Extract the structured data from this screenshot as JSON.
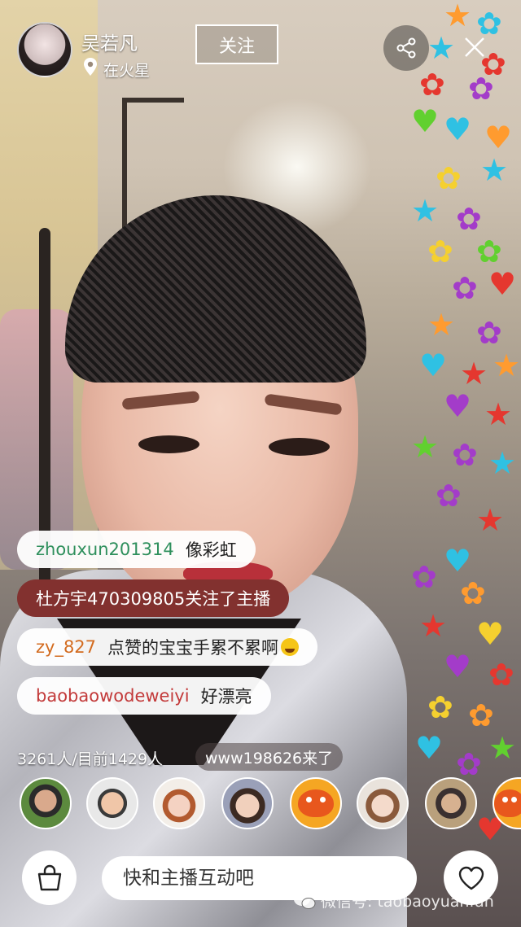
{
  "anchor": {
    "name": "吴若凡",
    "location": "在火星",
    "follow_label": "关注"
  },
  "icons": {
    "share": "share-icon",
    "close": "close-icon",
    "location": "location-pin-icon",
    "bag": "shopping-bag-icon",
    "like": "heart-icon"
  },
  "chat": [
    {
      "user": "zhouxun201314",
      "text": "像彩虹",
      "type": "normal",
      "user_color": "#2e8f5c"
    },
    {
      "user": "",
      "text": "杜方宇470309805关注了主播",
      "type": "system",
      "user_color": ""
    },
    {
      "user": "zy_827",
      "text": "点赞的宝宝手累不累啊",
      "type": "normal",
      "user_color": "#d36b1f",
      "emoji": "laughing-tears-emoji"
    },
    {
      "user": "baobaowodeweiyi",
      "text": "好漂亮",
      "type": "normal",
      "user_color": "#c33a3a"
    }
  ],
  "stats": {
    "viewers": "3261人/目前1429人",
    "joined": "www198626来了"
  },
  "bottom": {
    "input_placeholder": "快和主播互动吧"
  },
  "watermark": {
    "label": "微信号: taobaoyuanfan"
  },
  "colors": {
    "system_message_bg": "#82312f",
    "message_bg": "#ffffff",
    "accent": "#f5a623"
  }
}
